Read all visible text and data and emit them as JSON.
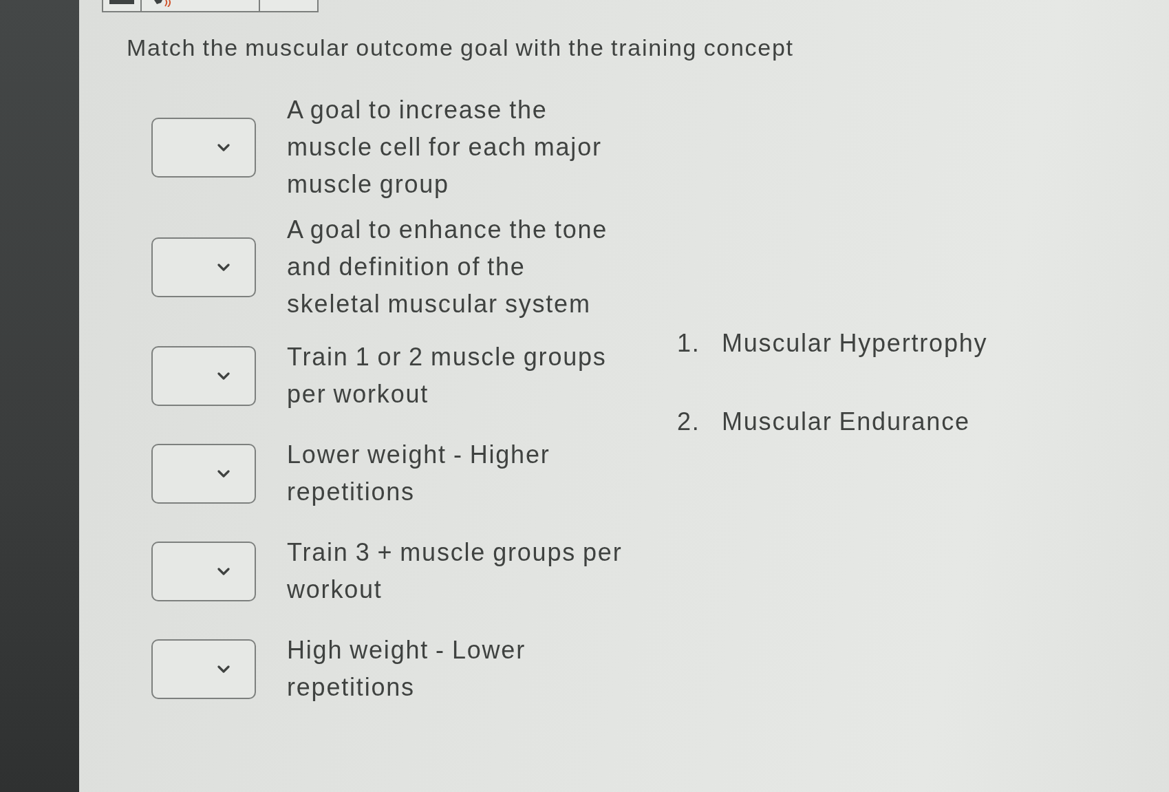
{
  "question": {
    "title": "Match the muscular outcome goal with the training concept"
  },
  "prompts": [
    {
      "text": "A goal to increase the muscle cell for each major muscle group"
    },
    {
      "text": "A goal to enhance the tone and definition of the skeletal muscular system"
    },
    {
      "text": "Train 1 or 2 muscle groups per workout"
    },
    {
      "text": "Lower weight - Higher repetitions"
    },
    {
      "text": "Train 3 + muscle groups per workout"
    },
    {
      "text": "High weight - Lower repetitions"
    }
  ],
  "answers": [
    {
      "number": "1.",
      "label": "Muscular Hypertrophy"
    },
    {
      "number": "2.",
      "label": "Muscular Endurance"
    }
  ]
}
